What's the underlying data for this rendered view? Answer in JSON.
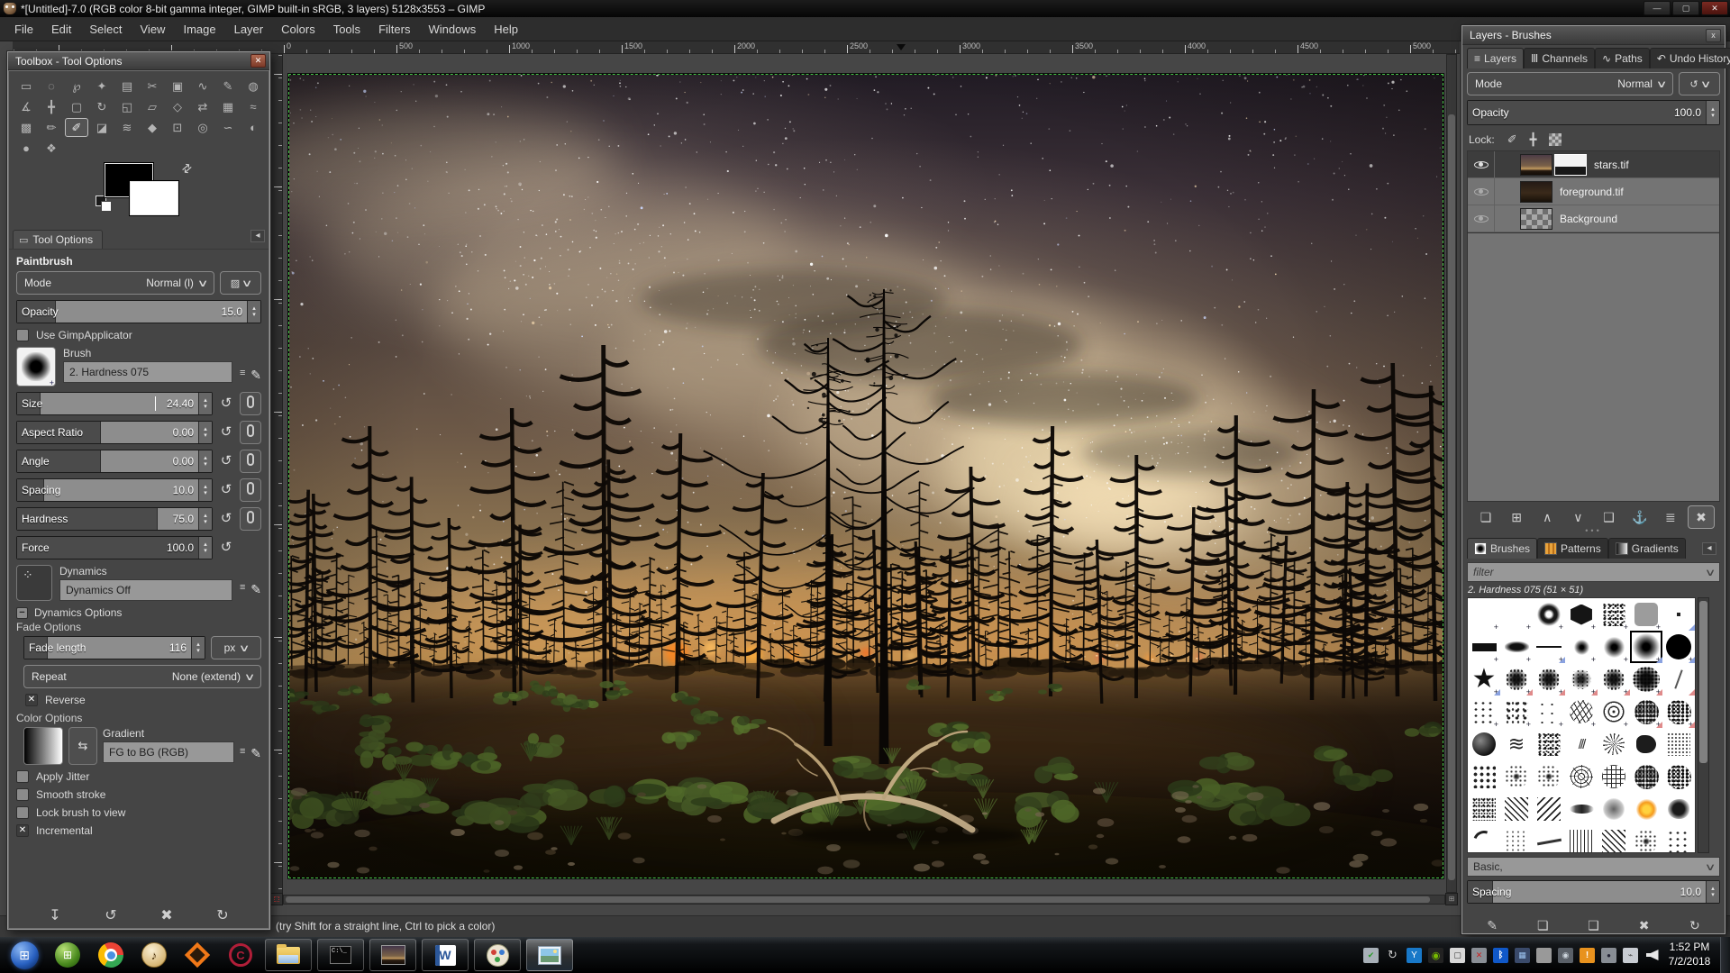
{
  "window": {
    "title": "*[Untitled]-7.0 (RGB color 8-bit gamma integer, GIMP built-in sRGB, 3 layers) 5128x3553 – GIMP",
    "controls": [
      "minimize",
      "maximize",
      "close"
    ]
  },
  "menu": {
    "items": [
      "File",
      "Edit",
      "Select",
      "View",
      "Image",
      "Layer",
      "Colors",
      "Tools",
      "Filters",
      "Windows",
      "Help"
    ]
  },
  "ruler": {
    "labels": [
      "0",
      "500",
      "1000",
      "1500",
      "2000",
      "2500",
      "3000",
      "3500",
      "4000",
      "4500",
      "5000"
    ]
  },
  "toolbox": {
    "title": "Toolbox - Tool Options",
    "tab_label": "Tool Options",
    "tool_heading": "Paintbrush",
    "tools": [
      {
        "name": "rectangle-select",
        "glyph": "▭"
      },
      {
        "name": "ellipse-select",
        "glyph": "◌"
      },
      {
        "name": "free-select",
        "glyph": "℘"
      },
      {
        "name": "fuzzy-select",
        "glyph": "✦"
      },
      {
        "name": "select-by-color",
        "glyph": "▤"
      },
      {
        "name": "scissors-select",
        "glyph": "✂"
      },
      {
        "name": "foreground-select",
        "glyph": "▣"
      },
      {
        "name": "paths",
        "glyph": "∿"
      },
      {
        "name": "color-picker",
        "glyph": "✎"
      },
      {
        "name": "zoom",
        "glyph": "◍"
      },
      {
        "name": "measure",
        "glyph": "∡"
      },
      {
        "name": "move",
        "glyph": "╋"
      },
      {
        "name": "crop",
        "glyph": "▢"
      },
      {
        "name": "rotate",
        "glyph": "↻"
      },
      {
        "name": "scale",
        "glyph": "◱"
      },
      {
        "name": "shear",
        "glyph": "▱"
      },
      {
        "name": "perspective",
        "glyph": "◇"
      },
      {
        "name": "flip",
        "glyph": "⇄"
      },
      {
        "name": "cage-transform",
        "glyph": "▦"
      },
      {
        "name": "warp-transform",
        "glyph": "≈"
      },
      {
        "name": "gradient",
        "glyph": "▩"
      },
      {
        "name": "pencil",
        "glyph": "✏"
      },
      {
        "name": "paintbrush",
        "glyph": "✐",
        "selected": true
      },
      {
        "name": "eraser",
        "glyph": "◪"
      },
      {
        "name": "airbrush",
        "glyph": "≋"
      },
      {
        "name": "ink",
        "glyph": "◆"
      },
      {
        "name": "clone",
        "glyph": "⊡"
      },
      {
        "name": "convolve",
        "glyph": "◎"
      },
      {
        "name": "smudge",
        "glyph": "∽"
      },
      {
        "name": "dodge-burn",
        "glyph": "◐"
      },
      {
        "name": "ink-blob",
        "glyph": "●"
      },
      {
        "name": "mypaint-brush",
        "glyph": "❖"
      }
    ],
    "mode": {
      "label": "Mode",
      "value": "Normal (l)"
    },
    "opacity": {
      "label": "Opacity",
      "value": "15.0"
    },
    "use_gimpapplicator_label": "Use GimpApplicator",
    "brush": {
      "label": "Brush",
      "value": "2. Hardness 075"
    },
    "sliders": {
      "size": {
        "label": "Size",
        "value": "24.40"
      },
      "aspect_ratio": {
        "label": "Aspect Ratio",
        "value": "0.00"
      },
      "angle": {
        "label": "Angle",
        "value": "0.00"
      },
      "spacing": {
        "label": "Spacing",
        "value": "10.0"
      },
      "hardness": {
        "label": "Hardness",
        "value": "75.0"
      },
      "force": {
        "label": "Force",
        "value": "100.0"
      }
    },
    "dynamics": {
      "label": "Dynamics",
      "value": "Dynamics Off"
    },
    "dynamics_options_label": "Dynamics Options",
    "fade_options_label": "Fade Options",
    "fade_length": {
      "label": "Fade length",
      "value": "116",
      "unit": "px"
    },
    "repeat": {
      "label": "Repeat",
      "value": "None (extend)"
    },
    "reverse": {
      "label": "Reverse",
      "checked": true
    },
    "color_options_label": "Color Options",
    "gradient": {
      "label": "Gradient",
      "value": "FG to BG (RGB)"
    },
    "apply_jitter": {
      "label": "Apply Jitter",
      "checked": false
    },
    "smooth_stroke": {
      "label": "Smooth stroke",
      "checked": false
    },
    "lock_brush": {
      "label": "Lock brush to view",
      "checked": false
    },
    "incremental": {
      "label": "Incremental",
      "checked": true
    },
    "footer_buttons": [
      {
        "name": "save-tool-preset",
        "glyph": "↧"
      },
      {
        "name": "restore-tool-preset",
        "glyph": "↺"
      },
      {
        "name": "delete-tool-preset",
        "glyph": "✖"
      },
      {
        "name": "reset-tool-options",
        "glyph": "↻"
      }
    ]
  },
  "canvas": {
    "statusbar_message": "(try Shift for a straight line, Ctrl to pick a color)"
  },
  "layers_panel": {
    "title": "Layers - Brushes",
    "tabs": [
      {
        "label": "Layers",
        "icon": "≡",
        "active": true
      },
      {
        "label": "Channels",
        "icon": "Ⅲ"
      },
      {
        "label": "Paths",
        "icon": "∿"
      },
      {
        "label": "Undo History",
        "icon": "↶"
      }
    ],
    "mode": {
      "label": "Mode",
      "value": "Normal"
    },
    "opacity": {
      "label": "Opacity",
      "value": "100.0"
    },
    "lock_label": "Lock:",
    "layers": [
      {
        "name": "stars.tif",
        "visible": true,
        "selected": true,
        "has_mask": true
      },
      {
        "name": "foreground.tif",
        "visible": true,
        "selected": false,
        "has_mask": false
      },
      {
        "name": "Background",
        "visible": true,
        "selected": false,
        "has_mask": false
      }
    ],
    "buttons": [
      {
        "name": "new-layer",
        "glyph": "❏"
      },
      {
        "name": "new-layer-group",
        "glyph": "⊞"
      },
      {
        "name": "raise-layer",
        "glyph": "∧"
      },
      {
        "name": "lower-layer",
        "glyph": "∨"
      },
      {
        "name": "duplicate-layer",
        "glyph": "❑"
      },
      {
        "name": "anchor-layer",
        "glyph": "⚓"
      },
      {
        "name": "merge-layer",
        "glyph": "≣"
      },
      {
        "name": "delete-layer",
        "glyph": "✖",
        "framed": true
      }
    ]
  },
  "brushes_panel": {
    "tabs": [
      {
        "label": "Brushes",
        "active": true
      },
      {
        "label": "Patterns",
        "active": false
      },
      {
        "label": "Gradients",
        "active": false
      }
    ],
    "filter_placeholder": "filter",
    "current_brush_label": "2. Hardness 075 (51 × 51)",
    "grid": [
      "blank+",
      "blank+",
      "ring+",
      "hex+",
      "noise+",
      "graysq+",
      "dot.b",
      "bar+",
      "hellipse+",
      "line+b",
      "soft1+",
      "soft2+",
      "soft3*+b",
      "circle+b",
      "star+b",
      "splat+r",
      "splat+r",
      "splat2+r",
      "splat+r",
      "splat3+r",
      "needle.r",
      "specks+",
      "specks2+",
      "sparse+",
      "vine+",
      "cells+",
      "grunge+r",
      "grunge2+r",
      "ball",
      "scribble",
      "noise",
      "sticks",
      "burst",
      "blob",
      "grain",
      "dots2",
      "spray",
      "spray",
      "web",
      "net",
      "grunge",
      "grunge2",
      "pepper",
      "hatch",
      "hatch2",
      "smear",
      "smoke",
      "sun",
      "blot",
      "arc",
      "dust",
      "streak",
      "lines",
      "hatch",
      "spray",
      "specks"
    ],
    "tag_value": "Basic,",
    "spacing": {
      "label": "Spacing",
      "value": "10.0"
    },
    "buttons": [
      {
        "name": "edit-brush",
        "glyph": "✎"
      },
      {
        "name": "new-brush",
        "glyph": "❏"
      },
      {
        "name": "duplicate-brush",
        "glyph": "❑"
      },
      {
        "name": "delete-brush",
        "glyph": "✖"
      },
      {
        "name": "refresh-brushes",
        "glyph": "↻"
      }
    ]
  },
  "taskbar": {
    "apps": [
      {
        "name": "start-button",
        "framed": false
      },
      {
        "name": "launcher-green",
        "framed": false
      },
      {
        "name": "chrome",
        "framed": false
      },
      {
        "name": "ivory",
        "framed": false
      },
      {
        "name": "reason",
        "framed": false
      },
      {
        "name": "cubase",
        "framed": false
      },
      {
        "name": "explorer",
        "framed": true
      },
      {
        "name": "command-prompt",
        "framed": true
      },
      {
        "name": "gimp",
        "framed": true
      },
      {
        "name": "word",
        "framed": true
      },
      {
        "name": "paint",
        "framed": true
      },
      {
        "name": "photo-viewer",
        "framed": true,
        "active": true
      }
    ],
    "tray": [
      "usb-safely-remove",
      "sync",
      "wireless-network",
      "nvidia-settings",
      "display",
      "device-error",
      "bluetooth",
      "graphics-panel",
      "usb-device",
      "camera",
      "backup-warning",
      "webcam",
      "power-plug",
      "volume"
    ],
    "clock": {
      "time": "1:52 PM",
      "date": "7/2/2018"
    }
  },
  "colors": {
    "layer_boundary": "#46c246",
    "fire_glow": "#ff9a30",
    "selection_row": "#3d3d3d",
    "slider_fill": "#4b4b4b"
  }
}
